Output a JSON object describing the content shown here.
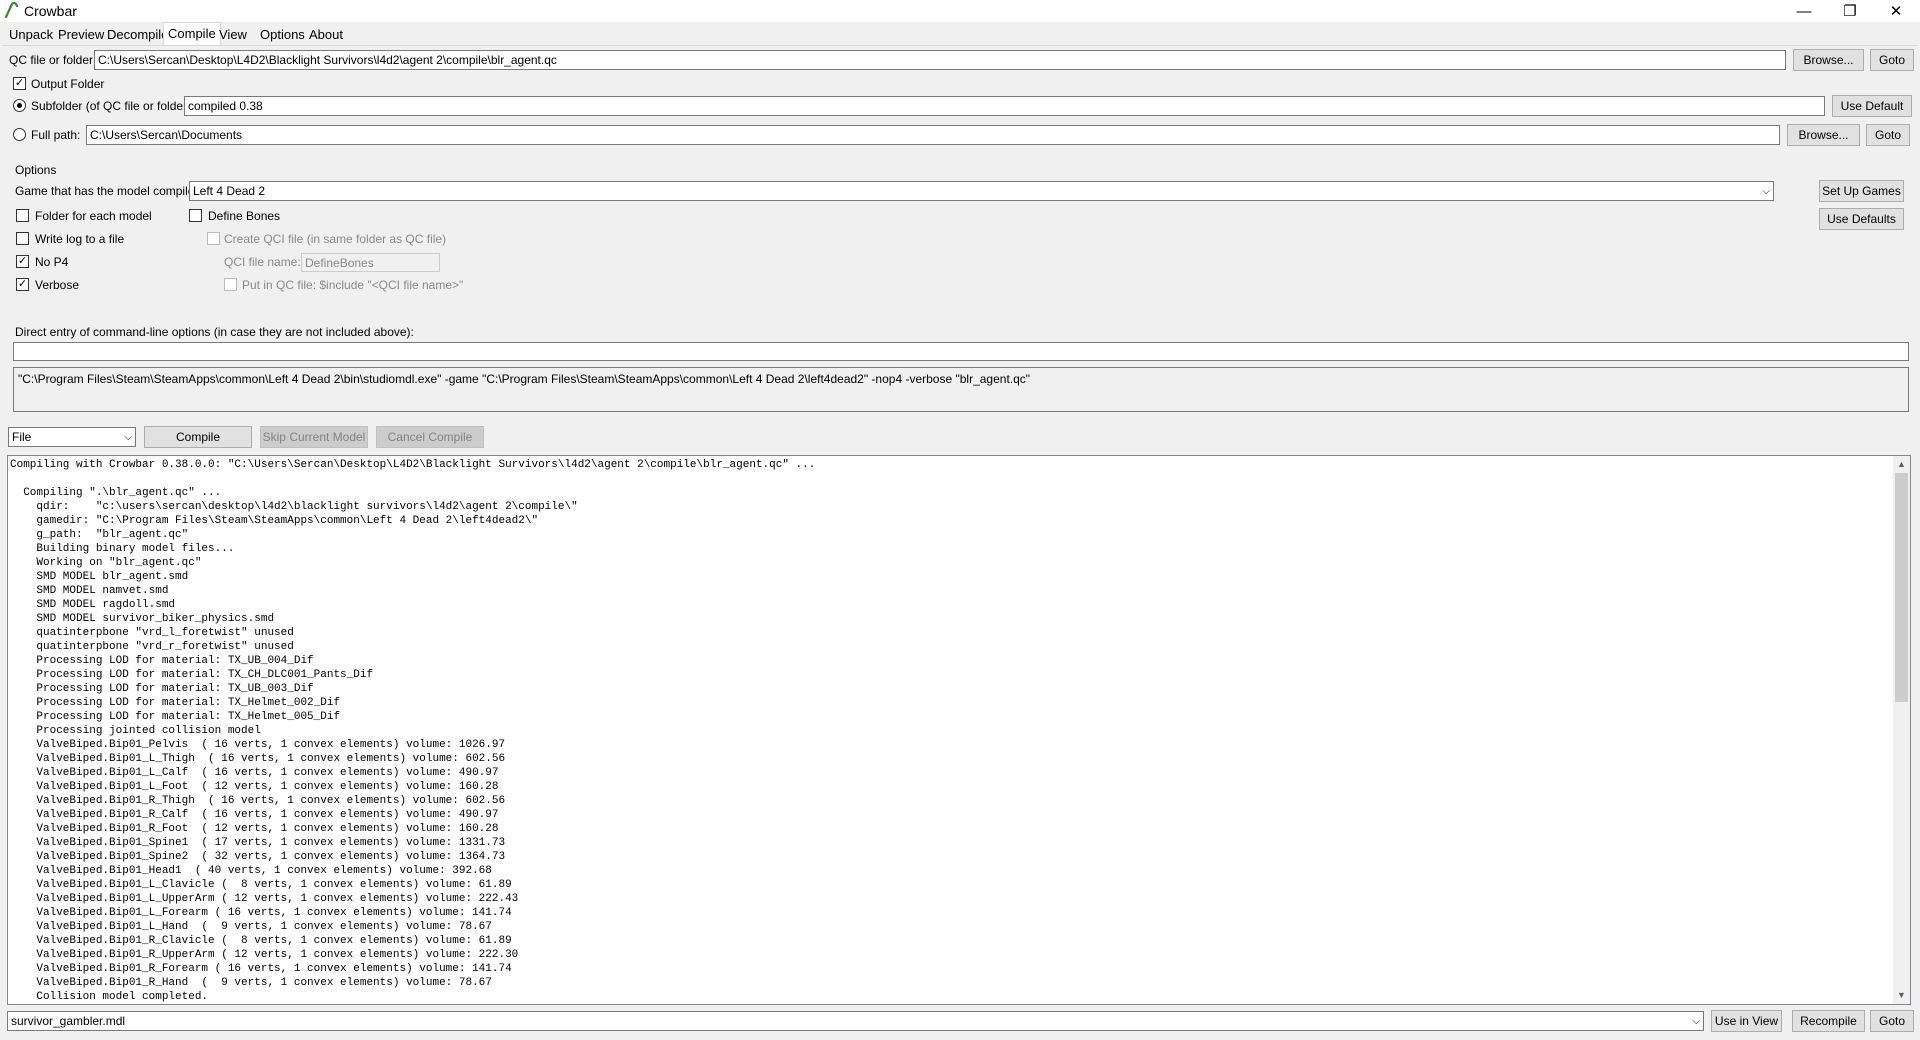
{
  "window": {
    "title": "Crowbar",
    "app_icon": "crowbar-icon",
    "controls": [
      "minimize-icon",
      "restore-icon",
      "close-icon"
    ]
  },
  "tabs": [
    {
      "label": "Unpack"
    },
    {
      "label": "Preview"
    },
    {
      "label": "Decompile"
    },
    {
      "label": "Compile",
      "active": true
    },
    {
      "label": "View"
    },
    {
      "label": "Options"
    },
    {
      "label": "About"
    }
  ],
  "qc": {
    "label": "QC file or folder:",
    "value": "C:\\Users\\Sercan\\Desktop\\L4D2\\Blacklight Survivors\\l4d2\\agent 2\\compile\\blr_agent.qc",
    "browse": "Browse...",
    "goto": "Goto"
  },
  "output": {
    "label": "Output Folder",
    "checked": true,
    "subfolder_label": "Subfolder (of QC file or folder):",
    "subfolder_value": "compiled 0.38",
    "use_default": "Use Default",
    "fullpath_label": "Full path:",
    "fullpath_value": "C:\\Users\\Sercan\\Documents",
    "browse": "Browse...",
    "goto": "Goto"
  },
  "options": {
    "section_label": "Options",
    "game_label": "Game that has the model compiler:",
    "game_value": "Left 4 Dead 2",
    "setup_games": "Set Up Games",
    "use_defaults": "Use Defaults",
    "folder_each_model": "Folder for each model",
    "define_bones": "Define Bones",
    "write_log": "Write log to a file",
    "create_qci": "Create QCI file (in same folder as QC file)",
    "qci_name_label": "QCI file name:",
    "qci_name_value": "DefineBones",
    "no_p4": "No P4",
    "verbose": "Verbose",
    "put_in_qc": "Put in QC file: $include \"<QCI file name>\""
  },
  "direct_entry": {
    "label": "Direct entry of command-line options (in case they are not included above):",
    "value": "",
    "command": "\"C:\\Program Files\\Steam\\SteamApps\\common\\Left 4 Dead 2\\bin\\studiomdl.exe\" -game \"C:\\Program Files\\Steam\\SteamApps\\common\\Left 4 Dead 2\\left4dead2\" -nop4 -verbose \"blr_agent.qc\""
  },
  "actions": {
    "mode": "File",
    "compile": "Compile",
    "skip": "Skip Current Model",
    "cancel": "Cancel Compile"
  },
  "log": {
    "lines": [
      "Compiling with Crowbar 0.38.0.0: \"C:\\Users\\Sercan\\Desktop\\L4D2\\Blacklight Survivors\\l4d2\\agent 2\\compile\\blr_agent.qc\" ...",
      "",
      "  Compiling \".\\blr_agent.qc\" ...",
      "    qdir:    \"c:\\users\\sercan\\desktop\\l4d2\\blacklight survivors\\l4d2\\agent 2\\compile\\\"",
      "    gamedir: \"C:\\Program Files\\Steam\\SteamApps\\common\\Left 4 Dead 2\\left4dead2\\\"",
      "    g_path:  \"blr_agent.qc\"",
      "    Building binary model files...",
      "    Working on \"blr_agent.qc\"",
      "    SMD MODEL blr_agent.smd",
      "    SMD MODEL namvet.smd",
      "    SMD MODEL ragdoll.smd",
      "    SMD MODEL survivor_biker_physics.smd",
      "    quatinterpbone \"vrd_l_foretwist\" unused",
      "    quatinterpbone \"vrd_r_foretwist\" unused",
      "    Processing LOD for material: TX_UB_004_Dif",
      "    Processing LOD for material: TX_CH_DLC001_Pants_Dif",
      "    Processing LOD for material: TX_UB_003_Dif",
      "    Processing LOD for material: TX_Helmet_002_Dif",
      "    Processing LOD for material: TX_Helmet_005_Dif",
      "    Processing jointed collision model",
      "    ValveBiped.Bip01_Pelvis  ( 16 verts, 1 convex elements) volume: 1026.97",
      "    ValveBiped.Bip01_L_Thigh  ( 16 verts, 1 convex elements) volume: 602.56",
      "    ValveBiped.Bip01_L_Calf  ( 16 verts, 1 convex elements) volume: 490.97",
      "    ValveBiped.Bip01_L_Foot  ( 12 verts, 1 convex elements) volume: 160.28",
      "    ValveBiped.Bip01_R_Thigh  ( 16 verts, 1 convex elements) volume: 602.56",
      "    ValveBiped.Bip01_R_Calf  ( 16 verts, 1 convex elements) volume: 490.97",
      "    ValveBiped.Bip01_R_Foot  ( 12 verts, 1 convex elements) volume: 160.28",
      "    ValveBiped.Bip01_Spine1  ( 17 verts, 1 convex elements) volume: 1331.73",
      "    ValveBiped.Bip01_Spine2  ( 32 verts, 1 convex elements) volume: 1364.73",
      "    ValveBiped.Bip01_Head1  ( 40 verts, 1 convex elements) volume: 392.68",
      "    ValveBiped.Bip01_L_Clavicle (  8 verts, 1 convex elements) volume: 61.89",
      "    ValveBiped.Bip01_L_UpperArm ( 12 verts, 1 convex elements) volume: 222.43",
      "    ValveBiped.Bip01_L_Forearm ( 16 verts, 1 convex elements) volume: 141.74",
      "    ValveBiped.Bip01_L_Hand  (  9 verts, 1 convex elements) volume: 78.67",
      "    ValveBiped.Bip01_R_Clavicle (  8 verts, 1 convex elements) volume: 61.89",
      "    ValveBiped.Bip01_R_UpperArm ( 12 verts, 1 convex elements) volume: 222.30",
      "    ValveBiped.Bip01_R_Forearm ( 16 verts, 1 convex elements) volume: 141.74",
      "    ValveBiped.Bip01_R_Hand  (  9 verts, 1 convex elements) volume: 78.67",
      "    Collision model completed."
    ]
  },
  "bottom": {
    "output_file": "survivor_gambler.mdl",
    "use_in_view": "Use in View",
    "recompile": "Recompile",
    "goto": "Goto"
  }
}
